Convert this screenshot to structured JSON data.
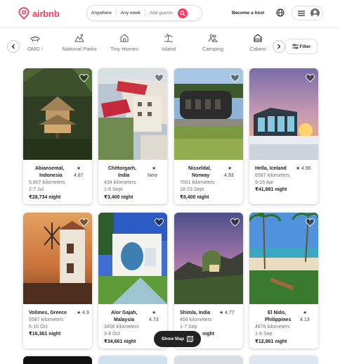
{
  "brand": {
    "name": "airbnb",
    "accent": "#ff385c"
  },
  "search": {
    "where": "Anywhere",
    "when": "Any week",
    "guests": "Add guests",
    "button_icon": "search-icon"
  },
  "header": {
    "host_link": "Become a host",
    "globe_icon": "globe-icon",
    "menu_icon": "hamburger-icon",
    "avatar_icon": "user-avatar-icon"
  },
  "categories": [
    {
      "label": "OMG !",
      "icon": "ufo-icon"
    },
    {
      "label": "National Parks",
      "icon": "park-icon"
    },
    {
      "label": "Tiny Homes",
      "icon": "tiny-home-icon"
    },
    {
      "label": "Island",
      "icon": "island-icon"
    },
    {
      "label": "Camping",
      "icon": "camping-icon"
    },
    {
      "label": "Cabins",
      "icon": "cabin-icon"
    }
  ],
  "filter": {
    "label": "Filter",
    "icon": "sliders-icon"
  },
  "listings": [
    {
      "title_lines": [
        "Abiansemal,",
        "Indonesia"
      ],
      "rating": "4.87",
      "distance": "5,807 kilometers",
      "dates": "2-7 Jul",
      "price": "₹28,734 night"
    },
    {
      "title_lines": [
        "Chittorgarh,",
        "India"
      ],
      "rating": "New",
      "distance": "434 kilometers",
      "dates": "1-6 Sept",
      "price": "₹3,400 night"
    },
    {
      "title_lines": [
        "Nisseldal,",
        "Norway"
      ],
      "rating": "4.93",
      "distance": "7001 kilometers",
      "dates": "18-23 Sept",
      "price": "₹8,400 night"
    },
    {
      "title_lines": [
        "Hella, Iceland"
      ],
      "rating": "4.96",
      "distance": "6587 kilometers",
      "dates": "9-16 Apr",
      "price": "₹41,881 night"
    },
    {
      "title_lines": [
        "Volimes, Greece"
      ],
      "rating": "4.9",
      "distance": "5587 kilometers",
      "dates": "5-10 Oct",
      "price": "₹16,361 night"
    },
    {
      "title_lines": [
        "Alor Gajah,",
        "Malaysia"
      ],
      "rating": "4.73",
      "distance": "3456 kilometers",
      "dates": "3-8 Oct",
      "price": "₹34,661 night"
    },
    {
      "title_lines": [
        "Shimla, India"
      ],
      "rating": "4.77",
      "distance": "456 kilometers",
      "dates": "1-7 Sep",
      "price": "night"
    },
    {
      "title_lines": [
        "El Nido,",
        "Philippines"
      ],
      "rating": "4.13",
      "distance": "4876 kilometers",
      "dates": "1-6 Sep",
      "price": "₹12,861 night"
    }
  ],
  "map_button": {
    "label": "Show Map",
    "icon": "map-icon"
  }
}
